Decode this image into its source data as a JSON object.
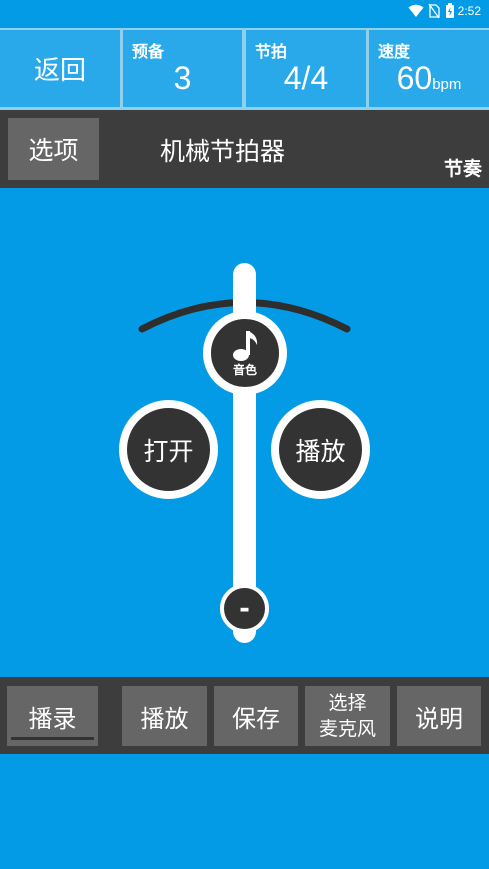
{
  "status_bar": {
    "time": "2:52"
  },
  "top_bar": {
    "back_label": "返回",
    "countin": {
      "label": "预备",
      "value": "3"
    },
    "beat": {
      "label": "节拍",
      "value": "4/4"
    },
    "tempo": {
      "label": "速度",
      "value": "60",
      "unit": "bpm"
    }
  },
  "title_bar": {
    "options_label": "选项",
    "title": "机械节拍器",
    "mode_label": "节奏"
  },
  "metronome": {
    "sound_label": "音色",
    "open_label": "打开",
    "play_label": "播放",
    "weight_label": "-"
  },
  "bottom_bar": {
    "record_label": "播录",
    "play_label": "播放",
    "save_label": "保存",
    "mic_line1": "选择",
    "mic_line2": "麦克风",
    "help_label": "说明"
  }
}
